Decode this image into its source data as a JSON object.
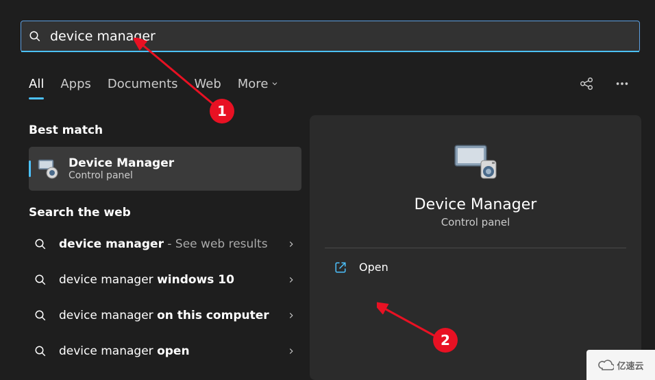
{
  "search": {
    "value": "device manager"
  },
  "tabs": {
    "items": [
      "All",
      "Apps",
      "Documents",
      "Web",
      "More"
    ],
    "active": 0
  },
  "results": {
    "best_match_heading": "Best match",
    "best_match": {
      "title": "Device Manager",
      "subtitle": "Control panel"
    },
    "web_heading": "Search the web",
    "web_items": [
      {
        "prefix": "device manager",
        "suffix": " - See web results",
        "suffix_dim": true
      },
      {
        "prefix": "device manager ",
        "bold": "windows 10"
      },
      {
        "prefix": "device manager ",
        "bold": "on this computer"
      },
      {
        "prefix": "device manager ",
        "bold": "open"
      }
    ]
  },
  "details": {
    "title": "Device Manager",
    "subtitle": "Control panel",
    "open_label": "Open"
  },
  "annotations": {
    "badge1": "1",
    "badge2": "2"
  },
  "watermark": "亿速云"
}
